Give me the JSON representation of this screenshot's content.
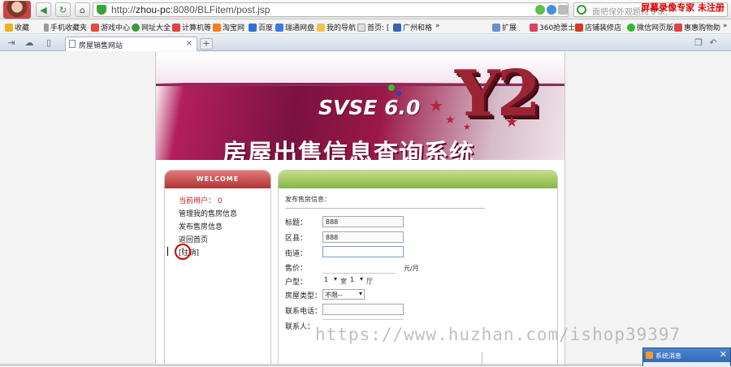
{
  "browser": {
    "url_prefix": "http://",
    "url_host": "zhou-pc",
    "url_path": ":8080/BLFitem/post.jsp",
    "search_placeholder": "面把保外观题材专家,",
    "watermark_top": "屏幕录像专家 未注册"
  },
  "bookmarks": [
    "收藏",
    "手机收藏夹",
    "游戏中心",
    "网址大全",
    "计算机等",
    "淘宝网",
    "百度",
    "瑞通网盘",
    "我的导航",
    "首页: [",
    "广州和格",
    "»",
    "扩展",
    "360抢票士",
    "店铺装修店",
    "微信网页版",
    "惠惠购物助",
    "»"
  ],
  "tab": {
    "title": "房屋销售网站"
  },
  "banner": {
    "svse": "SVSE 6.0",
    "y2": "Y2",
    "title": "房屋出售信息查询系统"
  },
  "sidebar": {
    "header": "WELCOME",
    "current_user": "当前用户： 0",
    "links": [
      "管理我的售房信息",
      "发布售房信息",
      "返回首页",
      "[注销]"
    ]
  },
  "form": {
    "section_title": "发布售房信息：",
    "title_label": "标题：",
    "title_value": "888",
    "district_label": "区县：",
    "district_value": "888",
    "street_label": "街道：",
    "street_value": "",
    "price_label": "售价：",
    "price_unit": "元/月",
    "layout_label": "户型：",
    "rooms_value": "1",
    "rooms_unit": "室",
    "halls_value": "1",
    "halls_unit": "厅",
    "type_label": "房屋类型：",
    "type_value": "不限--",
    "phone_label": "联系电话：",
    "contact_label": "联系人："
  },
  "cursor_glyph": "I",
  "popup": {
    "title": "系统消息",
    "close": "✕"
  },
  "watermark": "https://www.huzhan.com/ishop39397"
}
